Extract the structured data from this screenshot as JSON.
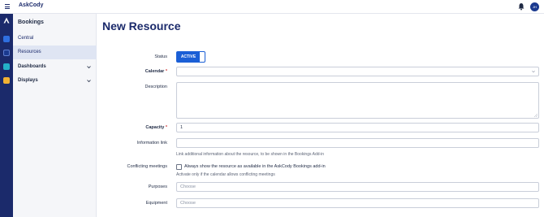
{
  "app": {
    "name": "AskCody"
  },
  "user": {
    "initials": "JH"
  },
  "sidebar": {
    "title": "Bookings",
    "items": [
      {
        "label": "Central"
      },
      {
        "label": "Resources"
      },
      {
        "label": "Dashboards"
      },
      {
        "label": "Displays"
      }
    ]
  },
  "form": {
    "title": "New Resource",
    "status": {
      "label": "Status",
      "value": "ACTIVE"
    },
    "calendar": {
      "label": "Calendar",
      "required": "*",
      "value": ""
    },
    "description": {
      "label": "Description",
      "value": ""
    },
    "capacity": {
      "label": "Capacity",
      "required": "*",
      "value": "1"
    },
    "information_link": {
      "label": "Information link",
      "value": "",
      "help": "Link additional information about the resource, to be shown in the Bookings Add-in"
    },
    "conflicting_meetings": {
      "label": "Conflicting meetings",
      "checkbox_label": "Always show the resource as available in the AskCody Bookings add-in",
      "checked": false,
      "help": "Activate only if the calendar allows conflicting meetings"
    },
    "purposes": {
      "label": "Purposes",
      "placeholder": "Choose"
    },
    "equipment": {
      "label": "Equipment",
      "placeholder": "Choose"
    }
  },
  "colors": {
    "brand": "#1b2a6b",
    "accent": "#1b5fd6",
    "required": "#d03b3b",
    "rail_icons": [
      "#2f6fe0",
      "#1b3a8f",
      "#24b0c7",
      "#f2b233"
    ]
  },
  "icons": [
    "menu-icon",
    "bell-icon",
    "chevron-down-icon",
    "app-logo-icon"
  ]
}
